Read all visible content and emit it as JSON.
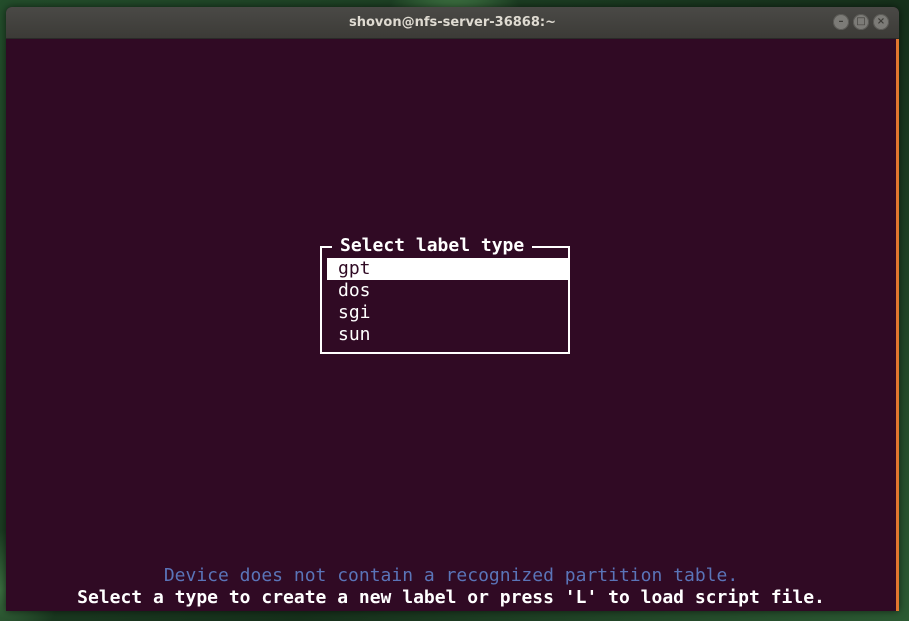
{
  "window": {
    "title": "shovon@nfs-server-36868:~",
    "controls": [
      "minimize-icon",
      "maximize-icon",
      "close-icon"
    ]
  },
  "dialog": {
    "title": "Select label type",
    "options": [
      {
        "label": "gpt",
        "selected": true
      },
      {
        "label": "dos",
        "selected": false
      },
      {
        "label": "sgi",
        "selected": false
      },
      {
        "label": "sun",
        "selected": false
      }
    ]
  },
  "messages": {
    "info": "Device does not contain a recognized partition table.",
    "help": "Select a type to create a new label or press 'L' to load script file."
  },
  "colors": {
    "terminal_bg": "#300a24",
    "info_text": "#5a74b8",
    "accent": "#e2772f"
  }
}
